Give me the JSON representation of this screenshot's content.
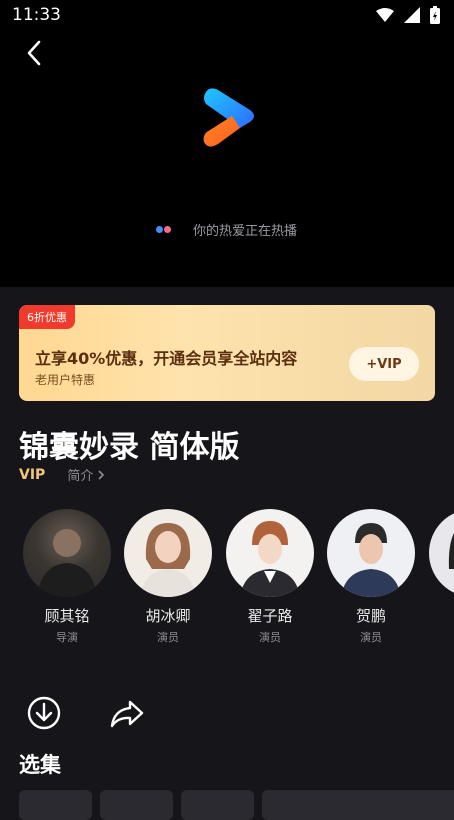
{
  "status_bar": {
    "time": "11:33"
  },
  "player": {
    "loading_text": "你的热爱正在热播"
  },
  "promo": {
    "badge": "6折优惠",
    "title": "立享40%优惠，开通会员享全站内容",
    "subtitle": "老用户特惠",
    "button": "+VIP"
  },
  "show": {
    "title": "锦囊妙录 简体版",
    "vip_tag": "VIP",
    "intro_label": "简介"
  },
  "cast": [
    {
      "name": "顾其铭",
      "role": "导演"
    },
    {
      "name": "胡冰卿",
      "role": "演员"
    },
    {
      "name": "翟子路",
      "role": "演员"
    },
    {
      "name": "贺鹏",
      "role": "演员"
    }
  ],
  "episodes": {
    "section_title": "选集"
  },
  "colors": {
    "accent_vip": "#f5c678",
    "badge_red": "#f03a2b",
    "background": "#16161a"
  }
}
